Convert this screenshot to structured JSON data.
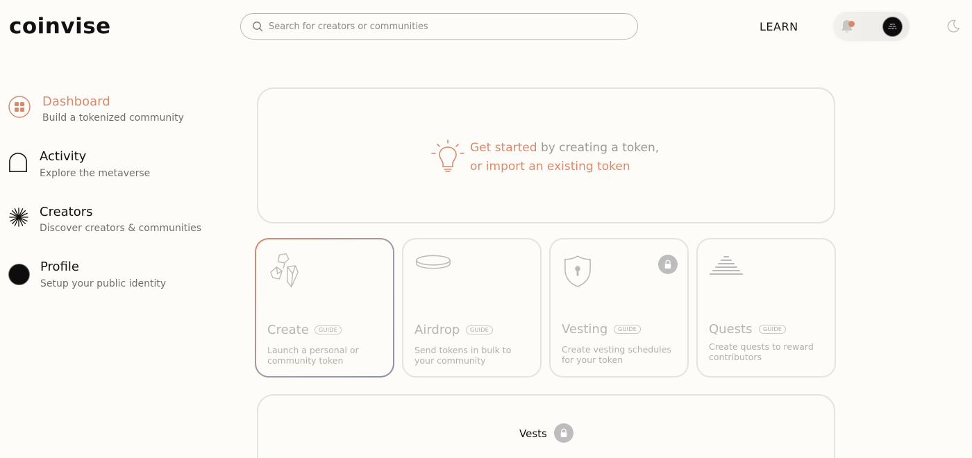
{
  "header": {
    "logo": "coinvise",
    "search_placeholder": "Search for creators or communities",
    "learn_label": "LEARN",
    "avatar_text": "ANTI SOCIAL SOCIETY"
  },
  "sidebar": {
    "items": [
      {
        "title": "Dashboard",
        "subtitle": "Build a tokenized community",
        "icon": "grid-icon",
        "active": true
      },
      {
        "title": "Activity",
        "subtitle": "Explore the metaverse",
        "icon": "arch-icon",
        "active": false
      },
      {
        "title": "Creators",
        "subtitle": "Discover creators & communities",
        "icon": "starburst-icon",
        "active": false
      },
      {
        "title": "Profile",
        "subtitle": "Setup your public identity",
        "icon": "avatar-icon",
        "active": false
      }
    ]
  },
  "hero": {
    "line1_accent": "Get started",
    "line1_rest": " by creating a token,",
    "line2": "or import an existing token"
  },
  "cards": [
    {
      "title": "Create",
      "badge": "GUIDE",
      "description": "Launch a personal or community token",
      "icon": "crystals-icon",
      "locked": false
    },
    {
      "title": "Airdrop",
      "badge": "GUIDE",
      "description": "Send tokens in bulk to your community",
      "icon": "ring-icon",
      "locked": false
    },
    {
      "title": "Vesting",
      "badge": "GUIDE",
      "description": "Create vesting schedules for your token",
      "icon": "shield-icon",
      "locked": true
    },
    {
      "title": "Quests",
      "badge": "GUIDE",
      "description": "Create quests to reward contributors",
      "icon": "pyramid-icon",
      "locked": false
    }
  ],
  "vests": {
    "title": "Vests"
  },
  "colors": {
    "accent": "#d98a6c",
    "card_border": "#e3e3e3",
    "muted": "#b5b5b5"
  }
}
